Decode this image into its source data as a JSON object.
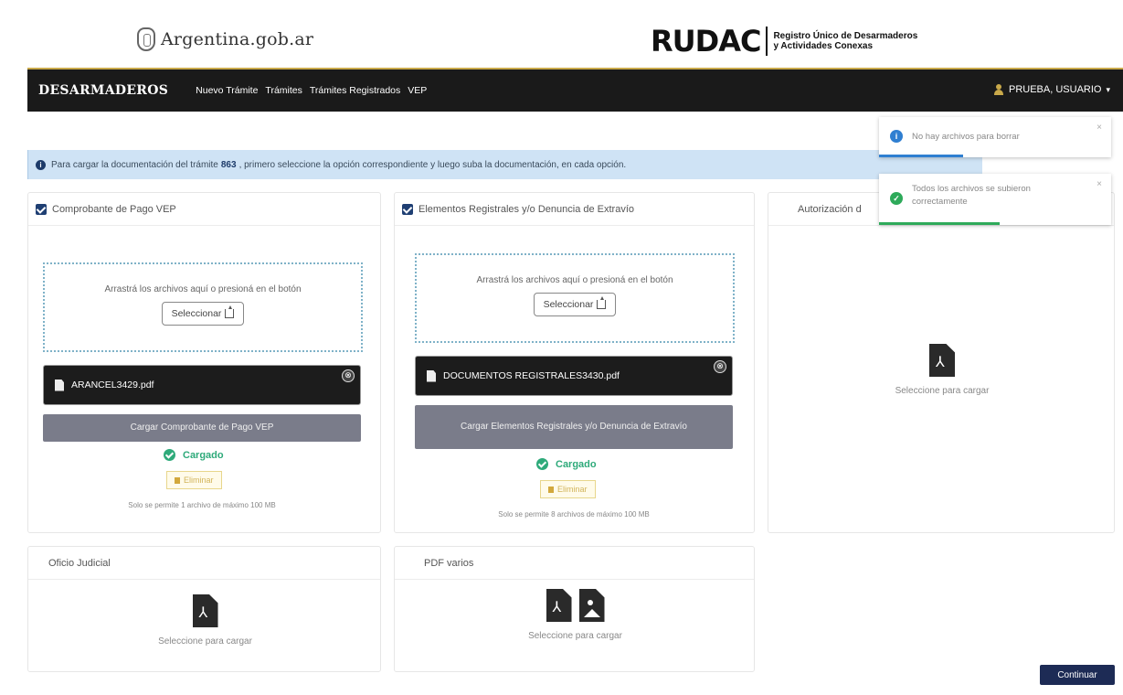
{
  "brand": {
    "gob_logo": "Argentina.gob.ar",
    "rudac_logo": "RUDAC",
    "rudac_subtitle_line1": "Registro Único de Desarmaderos",
    "rudac_subtitle_line2": "y Actividades Conexas"
  },
  "navbar": {
    "brand": "DESARMADEROS",
    "links": [
      "Nuevo Trámite",
      "Trámites",
      "Trámites Registrados",
      "VEP"
    ],
    "user": "PRUEBA, USUARIO",
    "user_caret": "▾"
  },
  "info_alert": {
    "text_before": "Para cargar la documentación del trámite",
    "tramite_number": "863",
    "text_after": ", primero seleccione la opción correspondiente y luego suba la documentación, en cada opción."
  },
  "cards": {
    "vep": {
      "title": "Comprobante de Pago VEP",
      "dropzone_text": "Arrastrá los archivos aquí o presioná en el botón",
      "select_button": "Seleccionar",
      "file_name": "ARANCEL3429.pdf",
      "remove_icon": "⊗",
      "upload_button": "Cargar Comprobante de Pago VEP",
      "status": "Cargado",
      "delete_button": "Eliminar",
      "note": "Solo se permite 1 archivo de máximo 100 MB"
    },
    "registrales": {
      "title": "Elementos Registrales y/o Denuncia de Extravío",
      "dropzone_text": "Arrastrá los archivos aquí o presioná en el botón",
      "select_button": "Seleccionar",
      "file_name": "DOCUMENTOS REGISTRALES3430.pdf",
      "remove_icon": "⊗",
      "upload_button": "Cargar Elementos Registrales y/o Denuncia de Extravío",
      "status": "Cargado",
      "delete_button": "Eliminar",
      "note": "Solo se permite 8 archivos de máximo 100 MB"
    },
    "autorizacion": {
      "title": "Autorización d",
      "select_text": "Seleccione para cargar"
    },
    "oficio": {
      "title": "Oficio Judicial",
      "select_text": "Seleccione para cargar"
    },
    "pdf_varios": {
      "title": "PDF varios",
      "select_text": "Seleccione para cargar"
    }
  },
  "toasts": {
    "info": {
      "text": "No hay archivos para borrar",
      "icon": "i",
      "close": "×",
      "color": "#2f7fd1"
    },
    "success": {
      "text": "Todos los archivos se subieron correctamente",
      "icon": "✓",
      "close": "×",
      "color": "#2eaa5a"
    }
  },
  "continue_button": "Continuar",
  "colors": {
    "navbar": "#1a1a1a",
    "accent_gold": "#c9a94a",
    "primary_blue": "#1d2b55",
    "success": "#2eaa7a",
    "info_bg": "#cfe3f5"
  }
}
